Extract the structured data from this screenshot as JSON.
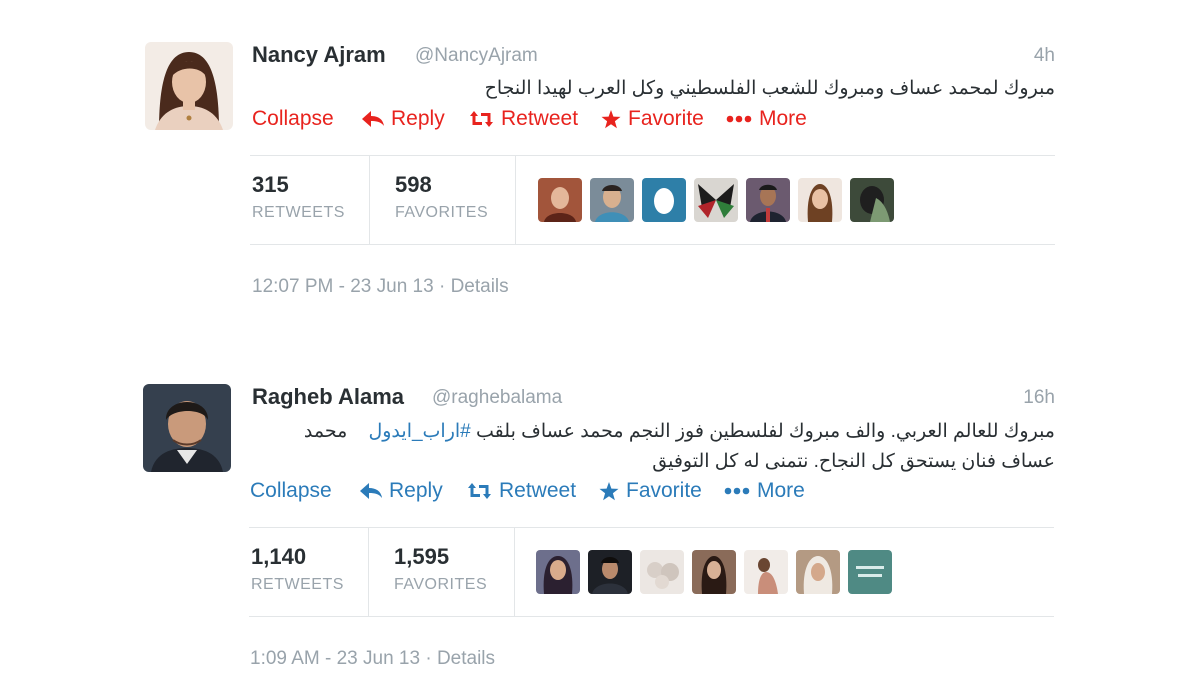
{
  "action_colors": {
    "tweet_1": "#e8231e",
    "tweet_2": "#2b7bb9"
  },
  "tweets": [
    {
      "fullname": "Nancy Ajram",
      "username": "@NancyAjram",
      "time": "4h",
      "text_lines": [
        "مبروك لمحمد عساف ومبروك للشعب الفلسطيني وكل العرب لهيدا النجاح"
      ],
      "actions": {
        "collapse": "Collapse",
        "reply": "Reply",
        "retweet": "Retweet",
        "favorite": "Favorite",
        "more": "More"
      },
      "stats": {
        "retweets_count": "315",
        "retweets_label": "RETWEETS",
        "favorites_count": "598",
        "favorites_label": "FAVORITES"
      },
      "favoriters": [
        "user-photo",
        "user-photo",
        "default-egg-avatar",
        "butterfly-photo",
        "user-photo",
        "user-photo",
        "user-photo"
      ],
      "footer": {
        "timestamp": "12:07 PM - 23 Jun 13",
        "separator": "·",
        "details": "Details"
      }
    },
    {
      "fullname": "Ragheb Alama",
      "username": "@raghebalama",
      "time": "16h",
      "text_line1_main": "مبروك للعالم العربي. والف مبروك لفلسطين فوز النجم محمد عساف بلقب",
      "text_line1_hashtag": "#اراب_ايدول",
      "text_line1_end": "محمد",
      "text_line2": "عساف فنان يستحق كل النجاح. نتمنى له كل التوفيق",
      "actions": {
        "collapse": "Collapse",
        "reply": "Reply",
        "retweet": "Retweet",
        "favorite": "Favorite",
        "more": "More"
      },
      "stats": {
        "retweets_count": "1,140",
        "retweets_label": "RETWEETS",
        "favorites_count": "1,595",
        "favorites_label": "FAVORITES"
      },
      "favoriters": [
        "user-photo",
        "user-photo",
        "plush-toy-photo",
        "user-photo",
        "user-photo",
        "user-photo",
        "text-image"
      ],
      "footer": {
        "timestamp": "1:09 AM - 23 Jun 13",
        "separator": "·",
        "details": "Details"
      }
    }
  ]
}
